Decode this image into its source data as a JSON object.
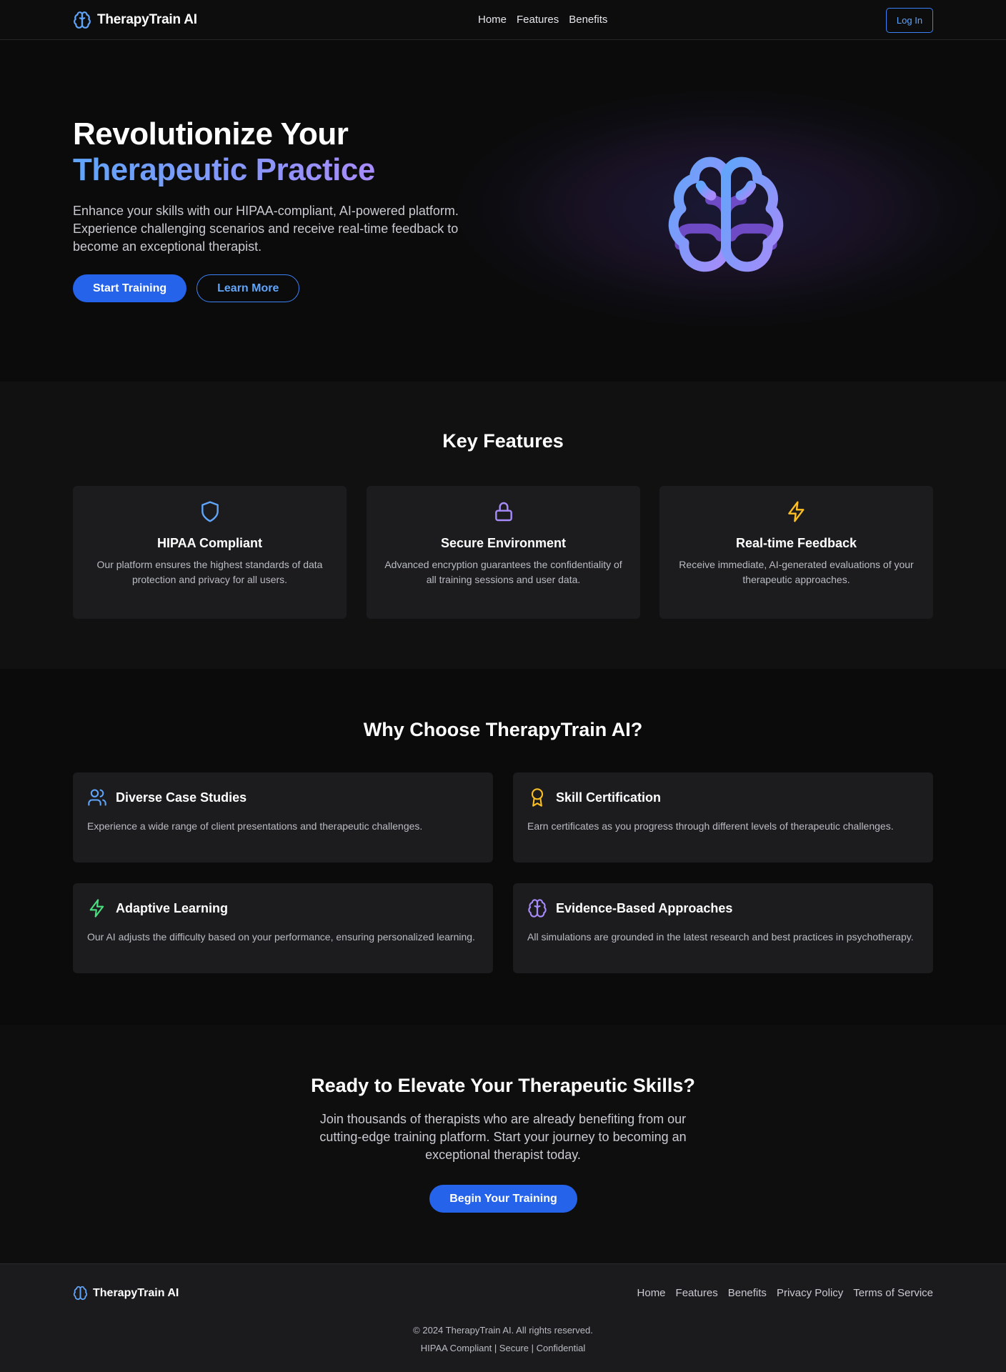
{
  "header": {
    "brand": "TherapyTrain AI",
    "nav": [
      "Home",
      "Features",
      "Benefits"
    ],
    "login_label": "Log In"
  },
  "hero": {
    "title_line1": "Revolutionize Your",
    "title_line2": "Therapeutic Practice",
    "description": "Enhance your skills with our HIPAA-compliant, AI-powered platform. Experience challenging scenarios and receive real-time feedback to become an exceptional therapist.",
    "primary_label": "Start Training",
    "secondary_label": "Learn More",
    "illustration_icon": "brain-icon"
  },
  "features": {
    "title": "Key Features",
    "items": [
      {
        "icon": "shield-icon",
        "title": "HIPAA Compliant",
        "description": "Our platform ensures the highest standards of data protection and privacy for all users."
      },
      {
        "icon": "lock-icon",
        "title": "Secure Environment",
        "description": "Advanced encryption guarantees the confidentiality of all training sessions and user data."
      },
      {
        "icon": "lightning-icon",
        "title": "Real-time Feedback",
        "description": "Receive immediate, AI-generated evaluations of your therapeutic approaches."
      }
    ]
  },
  "why": {
    "title": "Why Choose TherapyTrain AI?",
    "items": [
      {
        "icon": "users-icon",
        "title": "Diverse Case Studies",
        "description": "Experience a wide range of client presentations and therapeutic challenges."
      },
      {
        "icon": "award-icon",
        "title": "Skill Certification",
        "description": "Earn certificates as you progress through different levels of therapeutic challenges."
      },
      {
        "icon": "lightning-icon",
        "title": "Adaptive Learning",
        "description": "Our AI adjusts the difficulty based on your performance, ensuring personalized learning."
      },
      {
        "icon": "brain-icon",
        "title": "Evidence-Based Approaches",
        "description": "All simulations are grounded in the latest research and best practices in psychotherapy."
      }
    ]
  },
  "cta": {
    "title": "Ready to Elevate Your Therapeutic Skills?",
    "description": "Join thousands of therapists who are already benefiting from our cutting-edge training platform. Start your journey to becoming an exceptional therapist today.",
    "button_label": "Begin Your Training"
  },
  "footer": {
    "brand": "TherapyTrain AI",
    "links": [
      "Home",
      "Features",
      "Benefits",
      "Privacy Policy",
      "Terms of Service"
    ],
    "copyright": "© 2024 TherapyTrain AI. All rights reserved.",
    "tags": "HIPAA Compliant | Secure | Confidential"
  },
  "colors": {
    "accent_blue": "#2563eb",
    "link_blue": "#60a5fa",
    "purple": "#a78bfa",
    "yellow": "#fbbf24",
    "green": "#4ade80",
    "background": "#0b0b0c",
    "card": "#1c1c1e"
  }
}
